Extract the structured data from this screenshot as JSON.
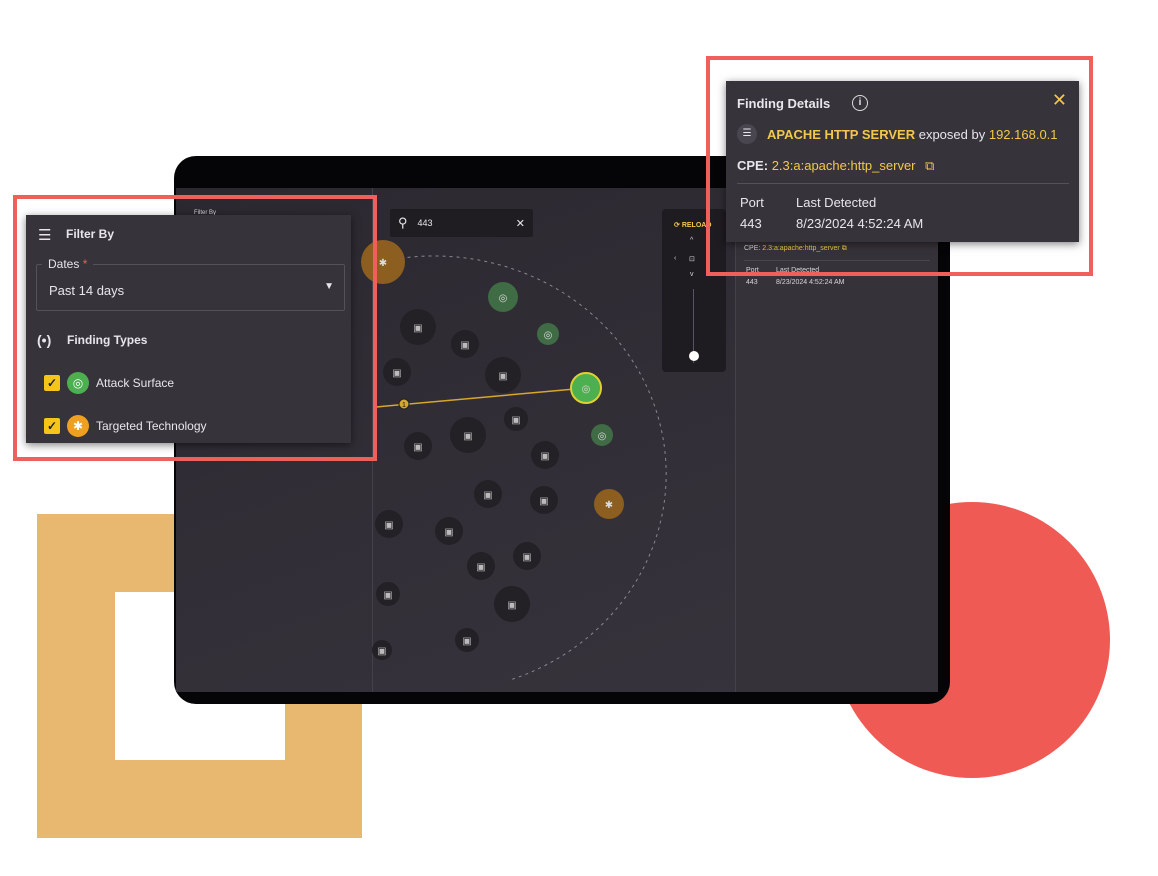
{
  "search": {
    "value": "443"
  },
  "controls": {
    "reload_label": "RELOAD",
    "zoom_level": 0.1
  },
  "background_panel": {
    "title": "Filter By",
    "cpe_label": "CPE:",
    "cpe_value": "2.3:a:apache:http_server",
    "port_header": "Port",
    "detected_header": "Last Detected",
    "port": "443",
    "detected": "8/23/2024 4:52:24 AM"
  },
  "filter": {
    "title": "Filter By",
    "dates_label": "Dates",
    "required_mark": "*",
    "dates_value": "Past 14 days",
    "finding_types_title": "Finding Types",
    "types": [
      {
        "label": "Attack Surface",
        "checked": true,
        "color": "#4caf50",
        "icon": "fingerprint-icon"
      },
      {
        "label": "Targeted Technology",
        "checked": true,
        "color": "#f0a020",
        "icon": "bug-icon"
      }
    ]
  },
  "details": {
    "title": "Finding Details",
    "technology": "APACHE HTTP SERVER",
    "exposed_by_text": "exposed by",
    "ip": "192.168.0.1",
    "cpe_label": "CPE:",
    "cpe_value": "2.3:a:apache:http_server",
    "port_header": "Port",
    "detected_header": "Last Detected",
    "port": "443",
    "detected": "8/23/2024 4:52:24 AM"
  },
  "graph": {
    "edge_badge": "1"
  },
  "colors": {
    "accent": "#f3c84a",
    "frame": "#f0605a",
    "attack_surface": "#4caf50",
    "targeted_technology": "#b8771f"
  }
}
